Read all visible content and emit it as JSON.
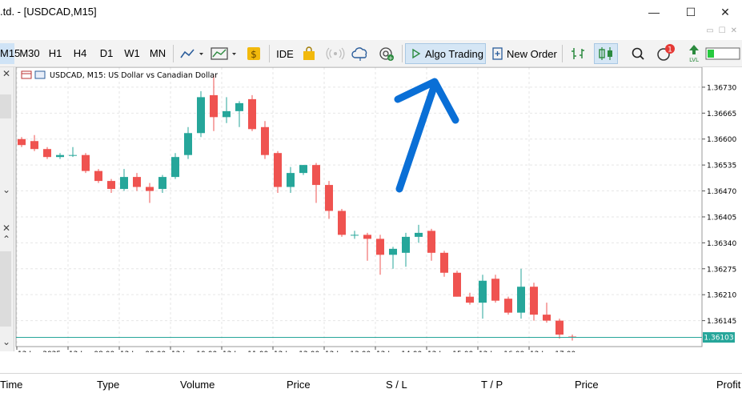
{
  "window": {
    "title": ".td. - [USDCAD,M15]",
    "minimize": "—",
    "maximize": "☐",
    "close": "✕"
  },
  "subwindow": {
    "controls": [
      "▭",
      "☐",
      "✕"
    ]
  },
  "toolbar": {
    "timeframes": [
      "M15",
      "M30",
      "H1",
      "H4",
      "D1",
      "W1",
      "MN"
    ],
    "active_timeframe": "M15",
    "ide_label": "IDE",
    "algo_trading_label": "Algo Trading",
    "new_order_label": "New Order",
    "notification_count": "1",
    "lvl_label": "LVL"
  },
  "chart": {
    "info_label": "USDCAD, M15:  US Dollar vs Canadian Dollar",
    "current_price": "1.36103",
    "price_labels": [
      "1.36730",
      "1.36665",
      "1.36600",
      "1.36535",
      "1.36470",
      "1.36405",
      "1.36340",
      "1.36275",
      "1.36210",
      "1.36145"
    ],
    "time_labels": [
      "12 Jun 2025",
      "12 Jun 08:00",
      "12 Jun 09:00",
      "12 Jun 10:00",
      "12 Jun 11:00",
      "12 Jun 12:00",
      "12 Jun 13:00",
      "12 Jun 14:00",
      "12 Jun 15:00",
      "12 Jun 16:00",
      "12 Jun 17:00"
    ],
    "colors": {
      "bull": "#26a69a",
      "bear": "#ef5350",
      "grid": "#e6e6e6",
      "current_line": "#26a69a",
      "arrow": "#0a6fd6"
    }
  },
  "chart_data": {
    "type": "candlestick",
    "symbol": "USDCAD",
    "timeframe": "M15",
    "ylim": [
      1.3608,
      1.3678
    ],
    "candles": [
      {
        "o": 1.366,
        "h": 1.36605,
        "l": 1.3658,
        "c": 1.36585
      },
      {
        "o": 1.36595,
        "h": 1.3661,
        "l": 1.3657,
        "c": 1.36575
      },
      {
        "o": 1.36575,
        "h": 1.3658,
        "l": 1.3655,
        "c": 1.36555
      },
      {
        "o": 1.36555,
        "h": 1.36565,
        "l": 1.3655,
        "c": 1.3656
      },
      {
        "o": 1.3656,
        "h": 1.3658,
        "l": 1.36555,
        "c": 1.3656
      },
      {
        "o": 1.3656,
        "h": 1.36565,
        "l": 1.36515,
        "c": 1.3652
      },
      {
        "o": 1.3652,
        "h": 1.36525,
        "l": 1.3649,
        "c": 1.36495
      },
      {
        "o": 1.36495,
        "h": 1.365,
        "l": 1.36465,
        "c": 1.36475
      },
      {
        "o": 1.36475,
        "h": 1.36525,
        "l": 1.3647,
        "c": 1.36505
      },
      {
        "o": 1.36505,
        "h": 1.36515,
        "l": 1.3647,
        "c": 1.3648
      },
      {
        "o": 1.3648,
        "h": 1.3649,
        "l": 1.3644,
        "c": 1.3647
      },
      {
        "o": 1.36475,
        "h": 1.3651,
        "l": 1.36465,
        "c": 1.36505
      },
      {
        "o": 1.36505,
        "h": 1.36565,
        "l": 1.365,
        "c": 1.36555
      },
      {
        "o": 1.3656,
        "h": 1.3663,
        "l": 1.3655,
        "c": 1.36615
      },
      {
        "o": 1.36615,
        "h": 1.3672,
        "l": 1.36605,
        "c": 1.36705
      },
      {
        "o": 1.3671,
        "h": 1.3676,
        "l": 1.3662,
        "c": 1.36655
      },
      {
        "o": 1.36655,
        "h": 1.36705,
        "l": 1.3664,
        "c": 1.3667
      },
      {
        "o": 1.3667,
        "h": 1.36695,
        "l": 1.3663,
        "c": 1.3669
      },
      {
        "o": 1.367,
        "h": 1.3671,
        "l": 1.3662,
        "c": 1.36625
      },
      {
        "o": 1.3663,
        "h": 1.36645,
        "l": 1.3655,
        "c": 1.3656
      },
      {
        "o": 1.36565,
        "h": 1.3657,
        "l": 1.36465,
        "c": 1.3648
      },
      {
        "o": 1.3648,
        "h": 1.3653,
        "l": 1.36465,
        "c": 1.36515
      },
      {
        "o": 1.36515,
        "h": 1.36535,
        "l": 1.3651,
        "c": 1.36535
      },
      {
        "o": 1.36535,
        "h": 1.3654,
        "l": 1.3644,
        "c": 1.36485
      },
      {
        "o": 1.36485,
        "h": 1.36495,
        "l": 1.364,
        "c": 1.3642
      },
      {
        "o": 1.3642,
        "h": 1.36425,
        "l": 1.36355,
        "c": 1.3636
      },
      {
        "o": 1.3636,
        "h": 1.3637,
        "l": 1.3635,
        "c": 1.3636
      },
      {
        "o": 1.3636,
        "h": 1.36365,
        "l": 1.36295,
        "c": 1.3635
      },
      {
        "o": 1.3635,
        "h": 1.3636,
        "l": 1.3626,
        "c": 1.3631
      },
      {
        "o": 1.3631,
        "h": 1.3633,
        "l": 1.36275,
        "c": 1.36325
      },
      {
        "o": 1.36315,
        "h": 1.36365,
        "l": 1.3628,
        "c": 1.36355
      },
      {
        "o": 1.36355,
        "h": 1.36385,
        "l": 1.3634,
        "c": 1.36365
      },
      {
        "o": 1.3637,
        "h": 1.36375,
        "l": 1.36295,
        "c": 1.36315
      },
      {
        "o": 1.36315,
        "h": 1.3632,
        "l": 1.36255,
        "c": 1.36265
      },
      {
        "o": 1.36265,
        "h": 1.3627,
        "l": 1.36205,
        "c": 1.36205
      },
      {
        "o": 1.36205,
        "h": 1.36215,
        "l": 1.36185,
        "c": 1.3619
      },
      {
        "o": 1.3619,
        "h": 1.3626,
        "l": 1.3615,
        "c": 1.36245
      },
      {
        "o": 1.3625,
        "h": 1.3626,
        "l": 1.3619,
        "c": 1.36195
      },
      {
        "o": 1.362,
        "h": 1.36205,
        "l": 1.3616,
        "c": 1.36165
      },
      {
        "o": 1.36165,
        "h": 1.36275,
        "l": 1.3615,
        "c": 1.3623
      },
      {
        "o": 1.3623,
        "h": 1.3624,
        "l": 1.36145,
        "c": 1.3616
      },
      {
        "o": 1.3616,
        "h": 1.3619,
        "l": 1.3614,
        "c": 1.36145
      },
      {
        "o": 1.36145,
        "h": 1.3615,
        "l": 1.361,
        "c": 1.3611
      },
      {
        "o": 1.36105,
        "h": 1.3611,
        "l": 1.36095,
        "c": 1.36103
      }
    ]
  },
  "bottom_panel": {
    "columns": [
      "Time",
      "Type",
      "Volume",
      "Price",
      "S / L",
      "T / P",
      "Price",
      "Profit"
    ]
  }
}
